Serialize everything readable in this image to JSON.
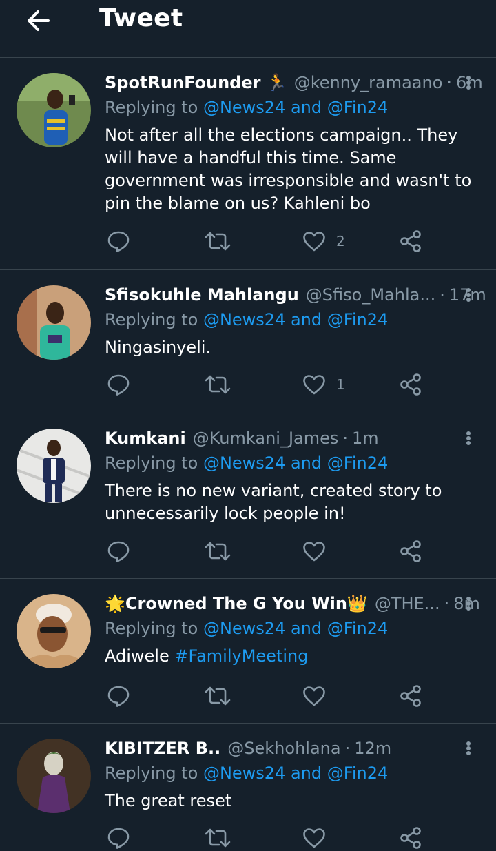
{
  "header": {
    "title": "Tweet"
  },
  "replying_prefix": "Replying to",
  "tweets": [
    {
      "display_name": "SpotRunFounder 🏃",
      "handle": "@kenny_ramaano",
      "dot": "·",
      "time": "6m",
      "replying_to": "@News24 and @Fin24",
      "body": "Not after all the elections campaign.. They will have a handful this time. Same government was irresponsible and wasn't to pin the blame on us? Kahleni bo",
      "likes": "2"
    },
    {
      "display_name": "Sfisokuhle Mahlangu",
      "handle": "@Sfiso_Mahla...",
      "dot": "·",
      "time": "17m",
      "replying_to": "@News24 and @Fin24",
      "body": "Ningasinyeli.",
      "likes": "1"
    },
    {
      "display_name": "Kumkani",
      "handle": "@Kumkani_James",
      "dot": "·",
      "time": "1m",
      "replying_to": "@News24 and @Fin24",
      "body": "There is no new variant, created story to unnecessarily lock people in!",
      "likes": ""
    },
    {
      "display_name": "🌟Crowned The G You Win👑",
      "handle": "@THE...",
      "dot": "·",
      "time": "8m",
      "replying_to": "@News24 and @Fin24",
      "body": "Adiwele",
      "hashtag": "#FamilyMeeting",
      "likes": ""
    },
    {
      "display_name": "KIBITZER B..",
      "handle": "@Sekhohlana",
      "dot": "·",
      "time": "12m",
      "replying_to": "@News24 and @Fin24",
      "body": "The great reset",
      "likes": ""
    }
  ],
  "colors": {
    "background": "#15202b",
    "divider": "#38444d",
    "muted": "#8899a6",
    "link": "#1d9bf0"
  },
  "icons": [
    "back-arrow-icon",
    "more-options-icon",
    "reply-icon",
    "retweet-icon",
    "like-icon",
    "share-icon"
  ]
}
